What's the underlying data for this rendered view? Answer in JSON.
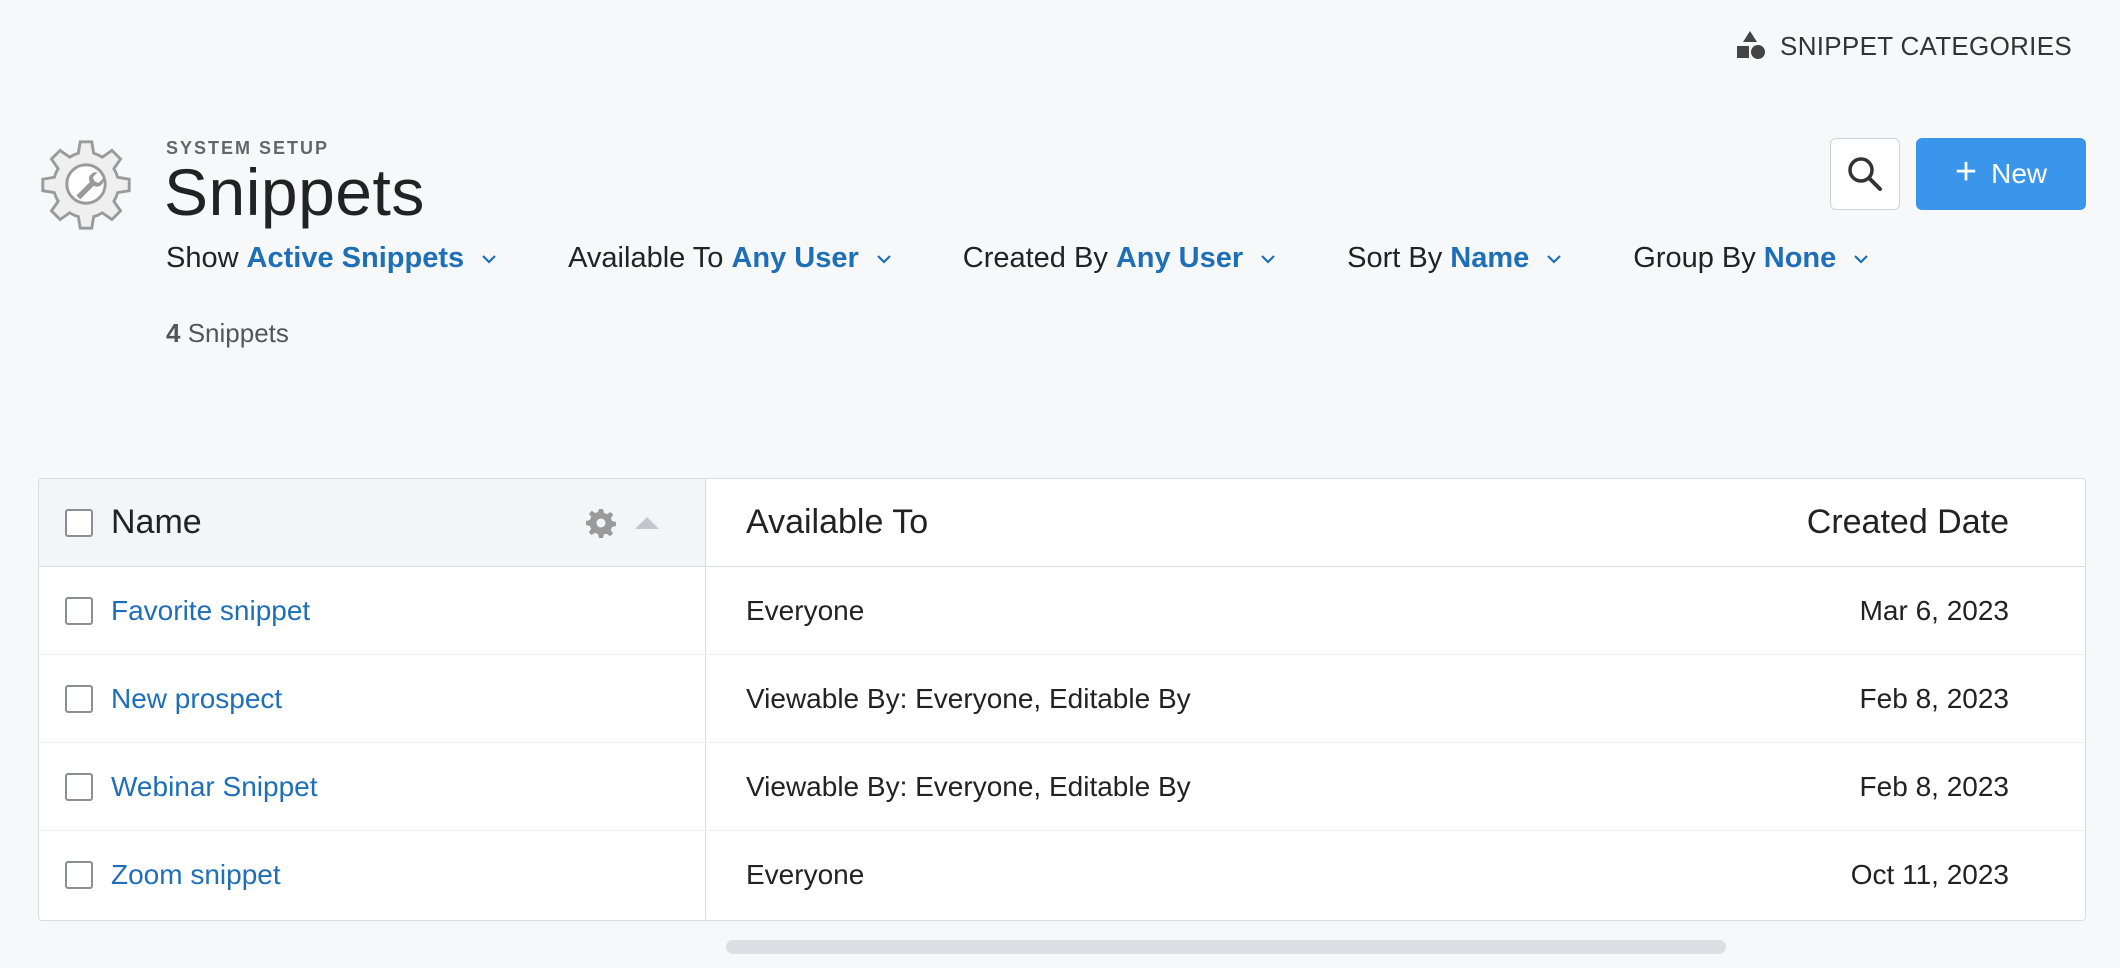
{
  "top_link": {
    "label": "SNIPPET CATEGORIES",
    "icon": "shapes-icon"
  },
  "header": {
    "overline": "SYSTEM SETUP",
    "title": "Snippets",
    "icon": "gear-wrench-icon"
  },
  "actions": {
    "search_icon": "search-icon",
    "new_label": "New",
    "new_color": "#3a96eb"
  },
  "filters": [
    {
      "label": "Show",
      "value": "Active Snippets"
    },
    {
      "label": "Available To",
      "value": "Any User"
    },
    {
      "label": "Created By",
      "value": "Any User"
    },
    {
      "label": "Sort By",
      "value": "Name"
    },
    {
      "label": "Group By",
      "value": "None"
    }
  ],
  "count": {
    "number": "4",
    "label": "Snippets"
  },
  "table": {
    "columns": {
      "name": "Name",
      "available_to": "Available To",
      "created_date": "Created Date"
    },
    "rows": [
      {
        "name": "Favorite snippet",
        "available_to": "Everyone",
        "created_date": "Mar 6, 2023"
      },
      {
        "name": "New prospect",
        "available_to": "Viewable By: Everyone, Editable By",
        "created_date": "Feb 8, 2023"
      },
      {
        "name": "Webinar Snippet",
        "available_to": "Viewable By: Everyone, Editable By",
        "created_date": "Feb 8, 2023"
      },
      {
        "name": "Zoom snippet",
        "available_to": "Everyone",
        "created_date": "Oct 11, 2023"
      }
    ]
  },
  "colors": {
    "link": "#1e6fb8",
    "accent": "#3a96eb",
    "background": "#f7f8fa"
  }
}
